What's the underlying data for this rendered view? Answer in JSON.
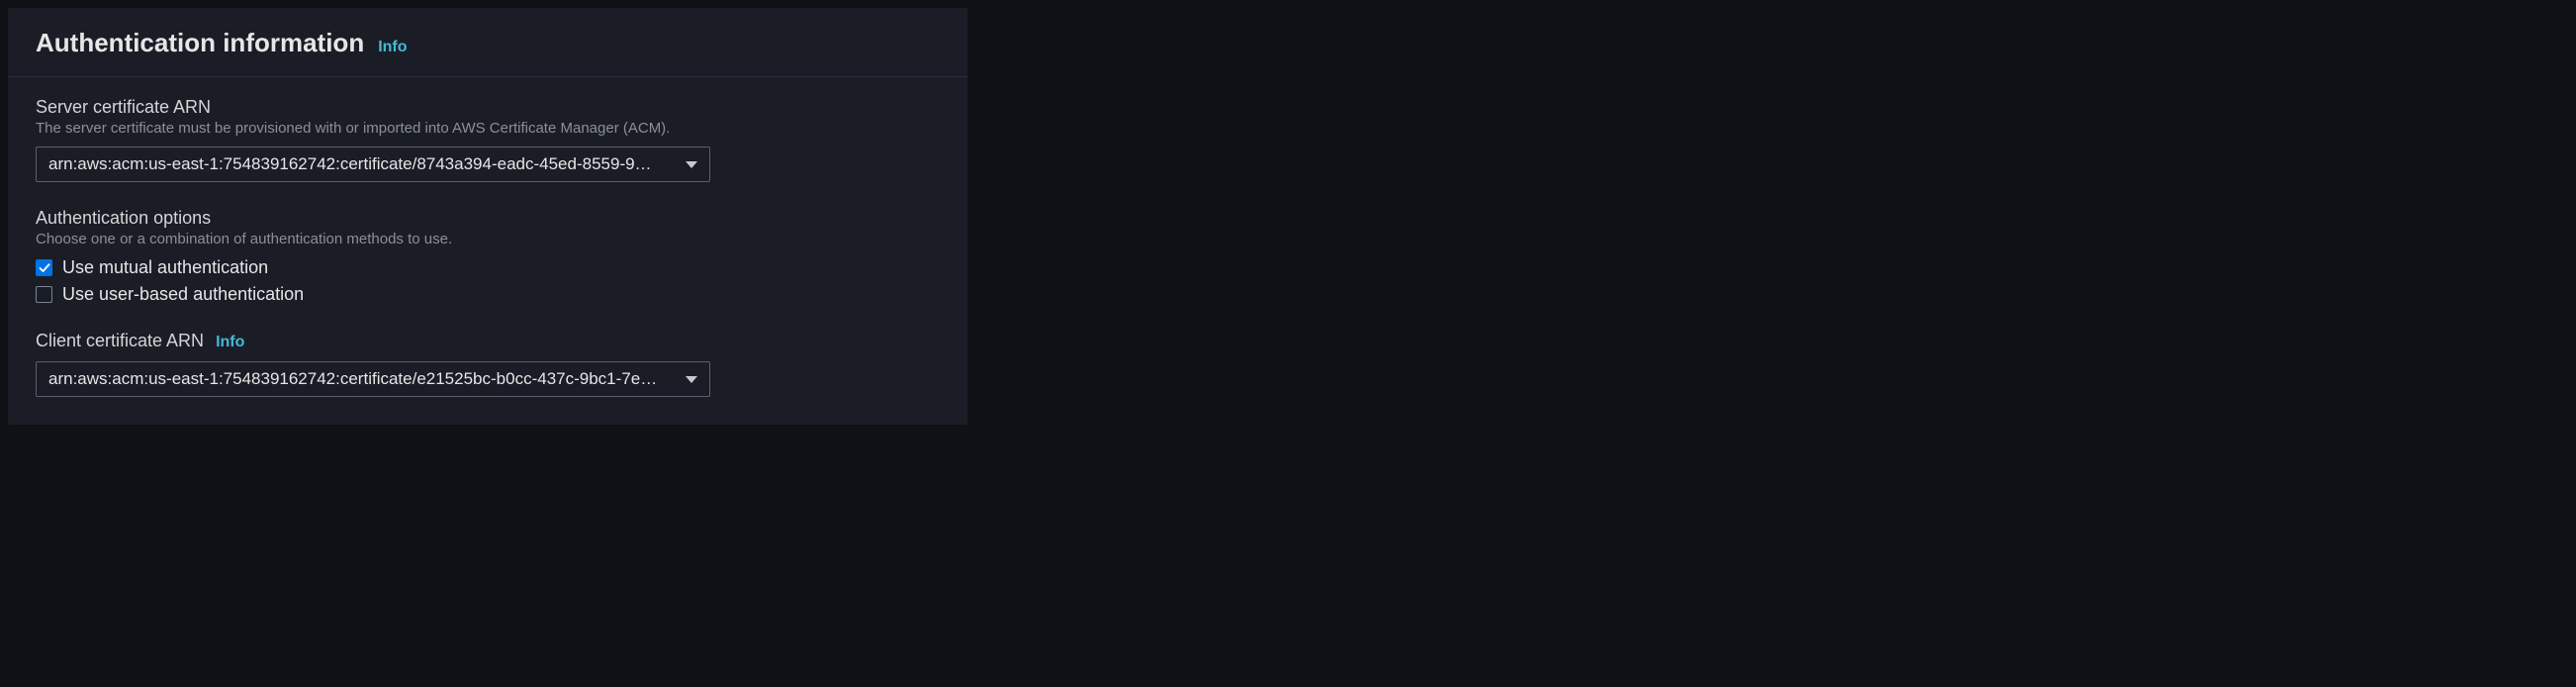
{
  "panel": {
    "title": "Authentication information",
    "infoLabel": "Info"
  },
  "serverCert": {
    "label": "Server certificate ARN",
    "help": "The server certificate must be provisioned with or imported into AWS Certificate Manager (ACM).",
    "value": "arn:aws:acm:us-east-1:754839162742:certificate/8743a394-eadc-45ed-8559-9…"
  },
  "authOptions": {
    "label": "Authentication options",
    "help": "Choose one or a combination of authentication methods to use.",
    "options": {
      "mutual": {
        "label": "Use mutual authentication",
        "checked": true
      },
      "userBased": {
        "label": "Use user-based authentication",
        "checked": false
      }
    }
  },
  "clientCert": {
    "label": "Client certificate ARN",
    "infoLabel": "Info",
    "value": "arn:aws:acm:us-east-1:754839162742:certificate/e21525bc-b0cc-437c-9bc1-7e…"
  }
}
